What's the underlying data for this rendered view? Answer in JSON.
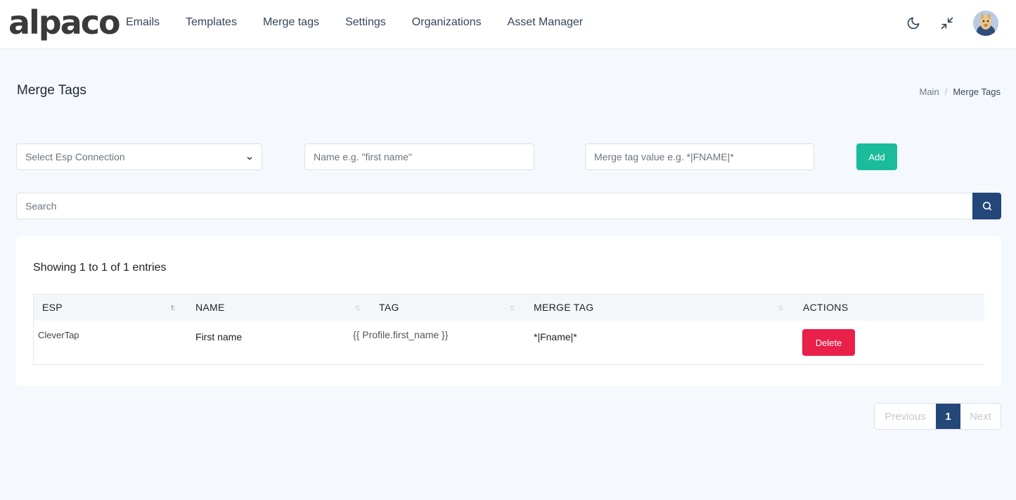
{
  "brand": {
    "logo_text": "alpaco"
  },
  "nav": [
    {
      "label": "Emails"
    },
    {
      "label": "Templates"
    },
    {
      "label": "Merge tags"
    },
    {
      "label": "Settings"
    },
    {
      "label": "Organizations"
    },
    {
      "label": "Asset Manager"
    }
  ],
  "header_icons": {
    "theme": "moon-icon",
    "fullscreen": "collapse-icon",
    "avatar": "alpaca-avatar"
  },
  "page": {
    "title": "Merge Tags"
  },
  "breadcrumb": {
    "main": "Main",
    "sep": "/",
    "current": "Merge Tags"
  },
  "form": {
    "esp_select_placeholder": "Select Esp Connection",
    "name_placeholder": "Name e.g. \"first name\"",
    "value_placeholder": "Merge tag value e.g. *|FNAME|*",
    "add_label": "Add"
  },
  "search": {
    "placeholder": "Search"
  },
  "table": {
    "showing": "Showing 1 to 1 of 1 entries",
    "headers": [
      "ESP",
      "NAME",
      "TAG",
      "MERGE TAG",
      "ACTIONS"
    ],
    "rows": [
      {
        "esp": "CleverTap",
        "name": "First name",
        "tag": "{{ Profile.first_name }}",
        "merge_tag": "*|Fname|*",
        "action": "Delete"
      }
    ]
  },
  "pagination": {
    "previous": "Previous",
    "current": "1",
    "next": "Next"
  },
  "colors": {
    "primary": "#24477a",
    "success": "#1bbc9b",
    "danger": "#e8204a",
    "background": "#f5f8fc"
  }
}
